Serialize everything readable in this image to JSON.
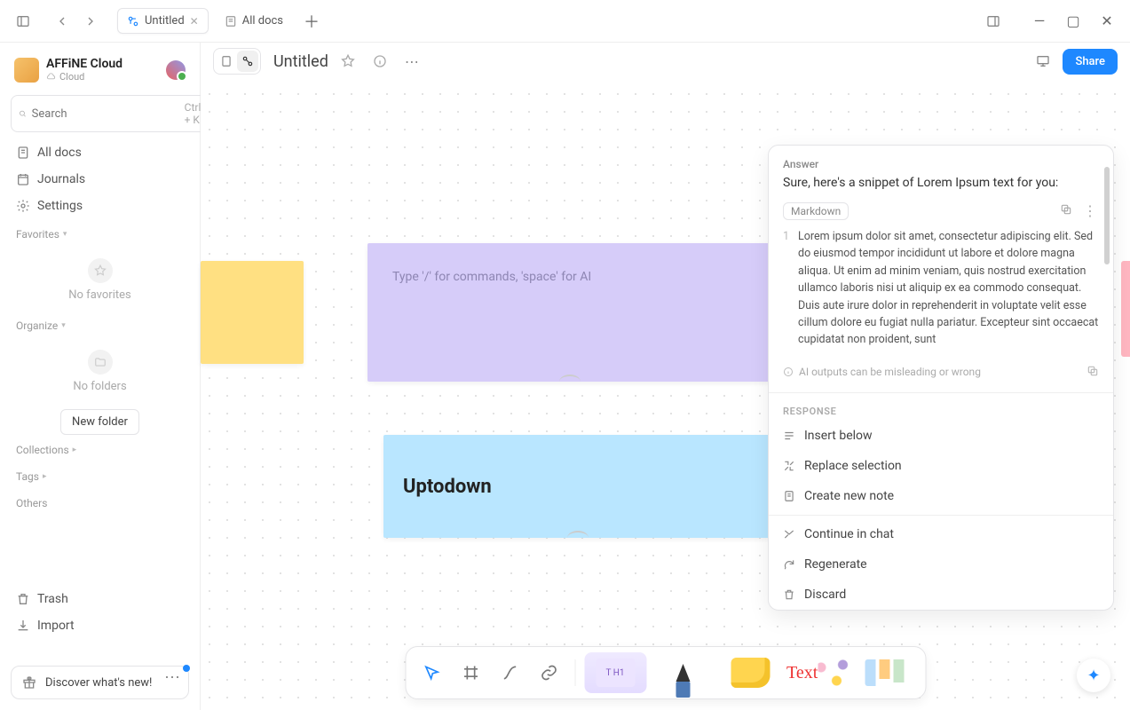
{
  "titlebar": {
    "tabs": [
      {
        "label": "Untitled",
        "active": true,
        "icon": "edgeless"
      },
      {
        "label": "All docs",
        "active": false,
        "icon": "docs"
      }
    ]
  },
  "sidebar": {
    "workspace": {
      "name": "AFFiNE Cloud",
      "sub": "Cloud"
    },
    "search": {
      "placeholder": "Search",
      "shortcut": "Ctrl + K"
    },
    "nav": {
      "all_docs": "All docs",
      "journals": "Journals",
      "settings": "Settings"
    },
    "sections": {
      "favorites_title": "Favorites",
      "favorites_empty": "No favorites",
      "organize_title": "Organize",
      "organize_empty": "No folders",
      "new_folder": "New folder",
      "collections_title": "Collections",
      "tags_title": "Tags",
      "others_title": "Others"
    },
    "bottom": {
      "trash": "Trash",
      "import": "Import",
      "whatsnew": "Discover what's new!"
    }
  },
  "doc": {
    "title": "Untitled",
    "share": "Share"
  },
  "canvas": {
    "purple_placeholder": "Type '/' for commands, 'space' for AI",
    "blue_text": "Uptodown"
  },
  "ai": {
    "answer_label": "Answer",
    "answer_text": "Sure, here's a snippet of Lorem Ipsum text for you:",
    "code_lang": "Markdown",
    "code_ln": "1",
    "code_body": "Lorem ipsum dolor sit amet, consectetur adipiscing elit. Sed do eiusmod tempor incididunt ut labore et dolore magna aliqua. Ut enim ad minim veniam, quis nostrud exercitation ullamco laboris nisi ut aliquip ex ea commodo consequat. Duis aute irure dolor in reprehenderit in voluptate velit esse cillum dolore eu fugiat nulla pariatur. Excepteur sint occaecat cupidatat non proident, sunt",
    "disclaimer": "AI outputs can be misleading or wrong",
    "response_label": "RESPONSE",
    "actions": {
      "insert_below": "Insert below",
      "replace_selection": "Replace selection",
      "create_new_note": "Create new note",
      "continue_in_chat": "Continue in chat",
      "regenerate": "Regenerate",
      "discard": "Discard"
    }
  }
}
